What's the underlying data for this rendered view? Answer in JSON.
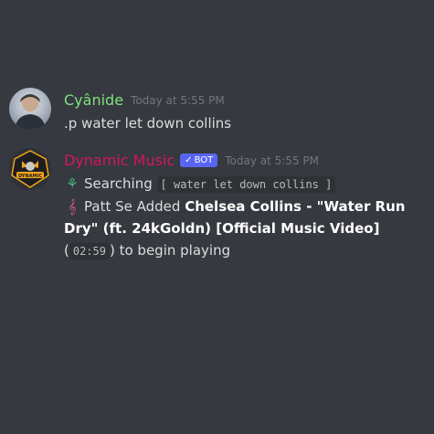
{
  "messages": [
    {
      "username": "Cyânide",
      "timestamp": "Today at 5:55 PM",
      "text": ".p water let down collins"
    },
    {
      "username": "Dynamic Music",
      "bot_tag": "BOT",
      "bot_check": "✓",
      "timestamp": "Today at 5:55 PM",
      "avatar_text": "DYNAMIC",
      "lines": {
        "searching": {
          "icon": "⚘",
          "icon_name": "spinner-icon",
          "label": "Searching",
          "code": "[ water let down collins ]"
        },
        "added": {
          "icon": "𝄞",
          "icon_name": "treble-clef-icon",
          "prefix": "Patt Se Added",
          "title": "Chelsea Collins - \"Water Run Dry\" (ft. 24kGoldn) [Official Music Video]",
          "open_paren": "(",
          "duration": "02:59",
          "suffix": ") to begin playing"
        }
      }
    }
  ],
  "colors": {
    "background": "#36393f",
    "user_name": "#7fe081",
    "bot_name": "#d6165b",
    "bot_tag": "#5865f2"
  }
}
